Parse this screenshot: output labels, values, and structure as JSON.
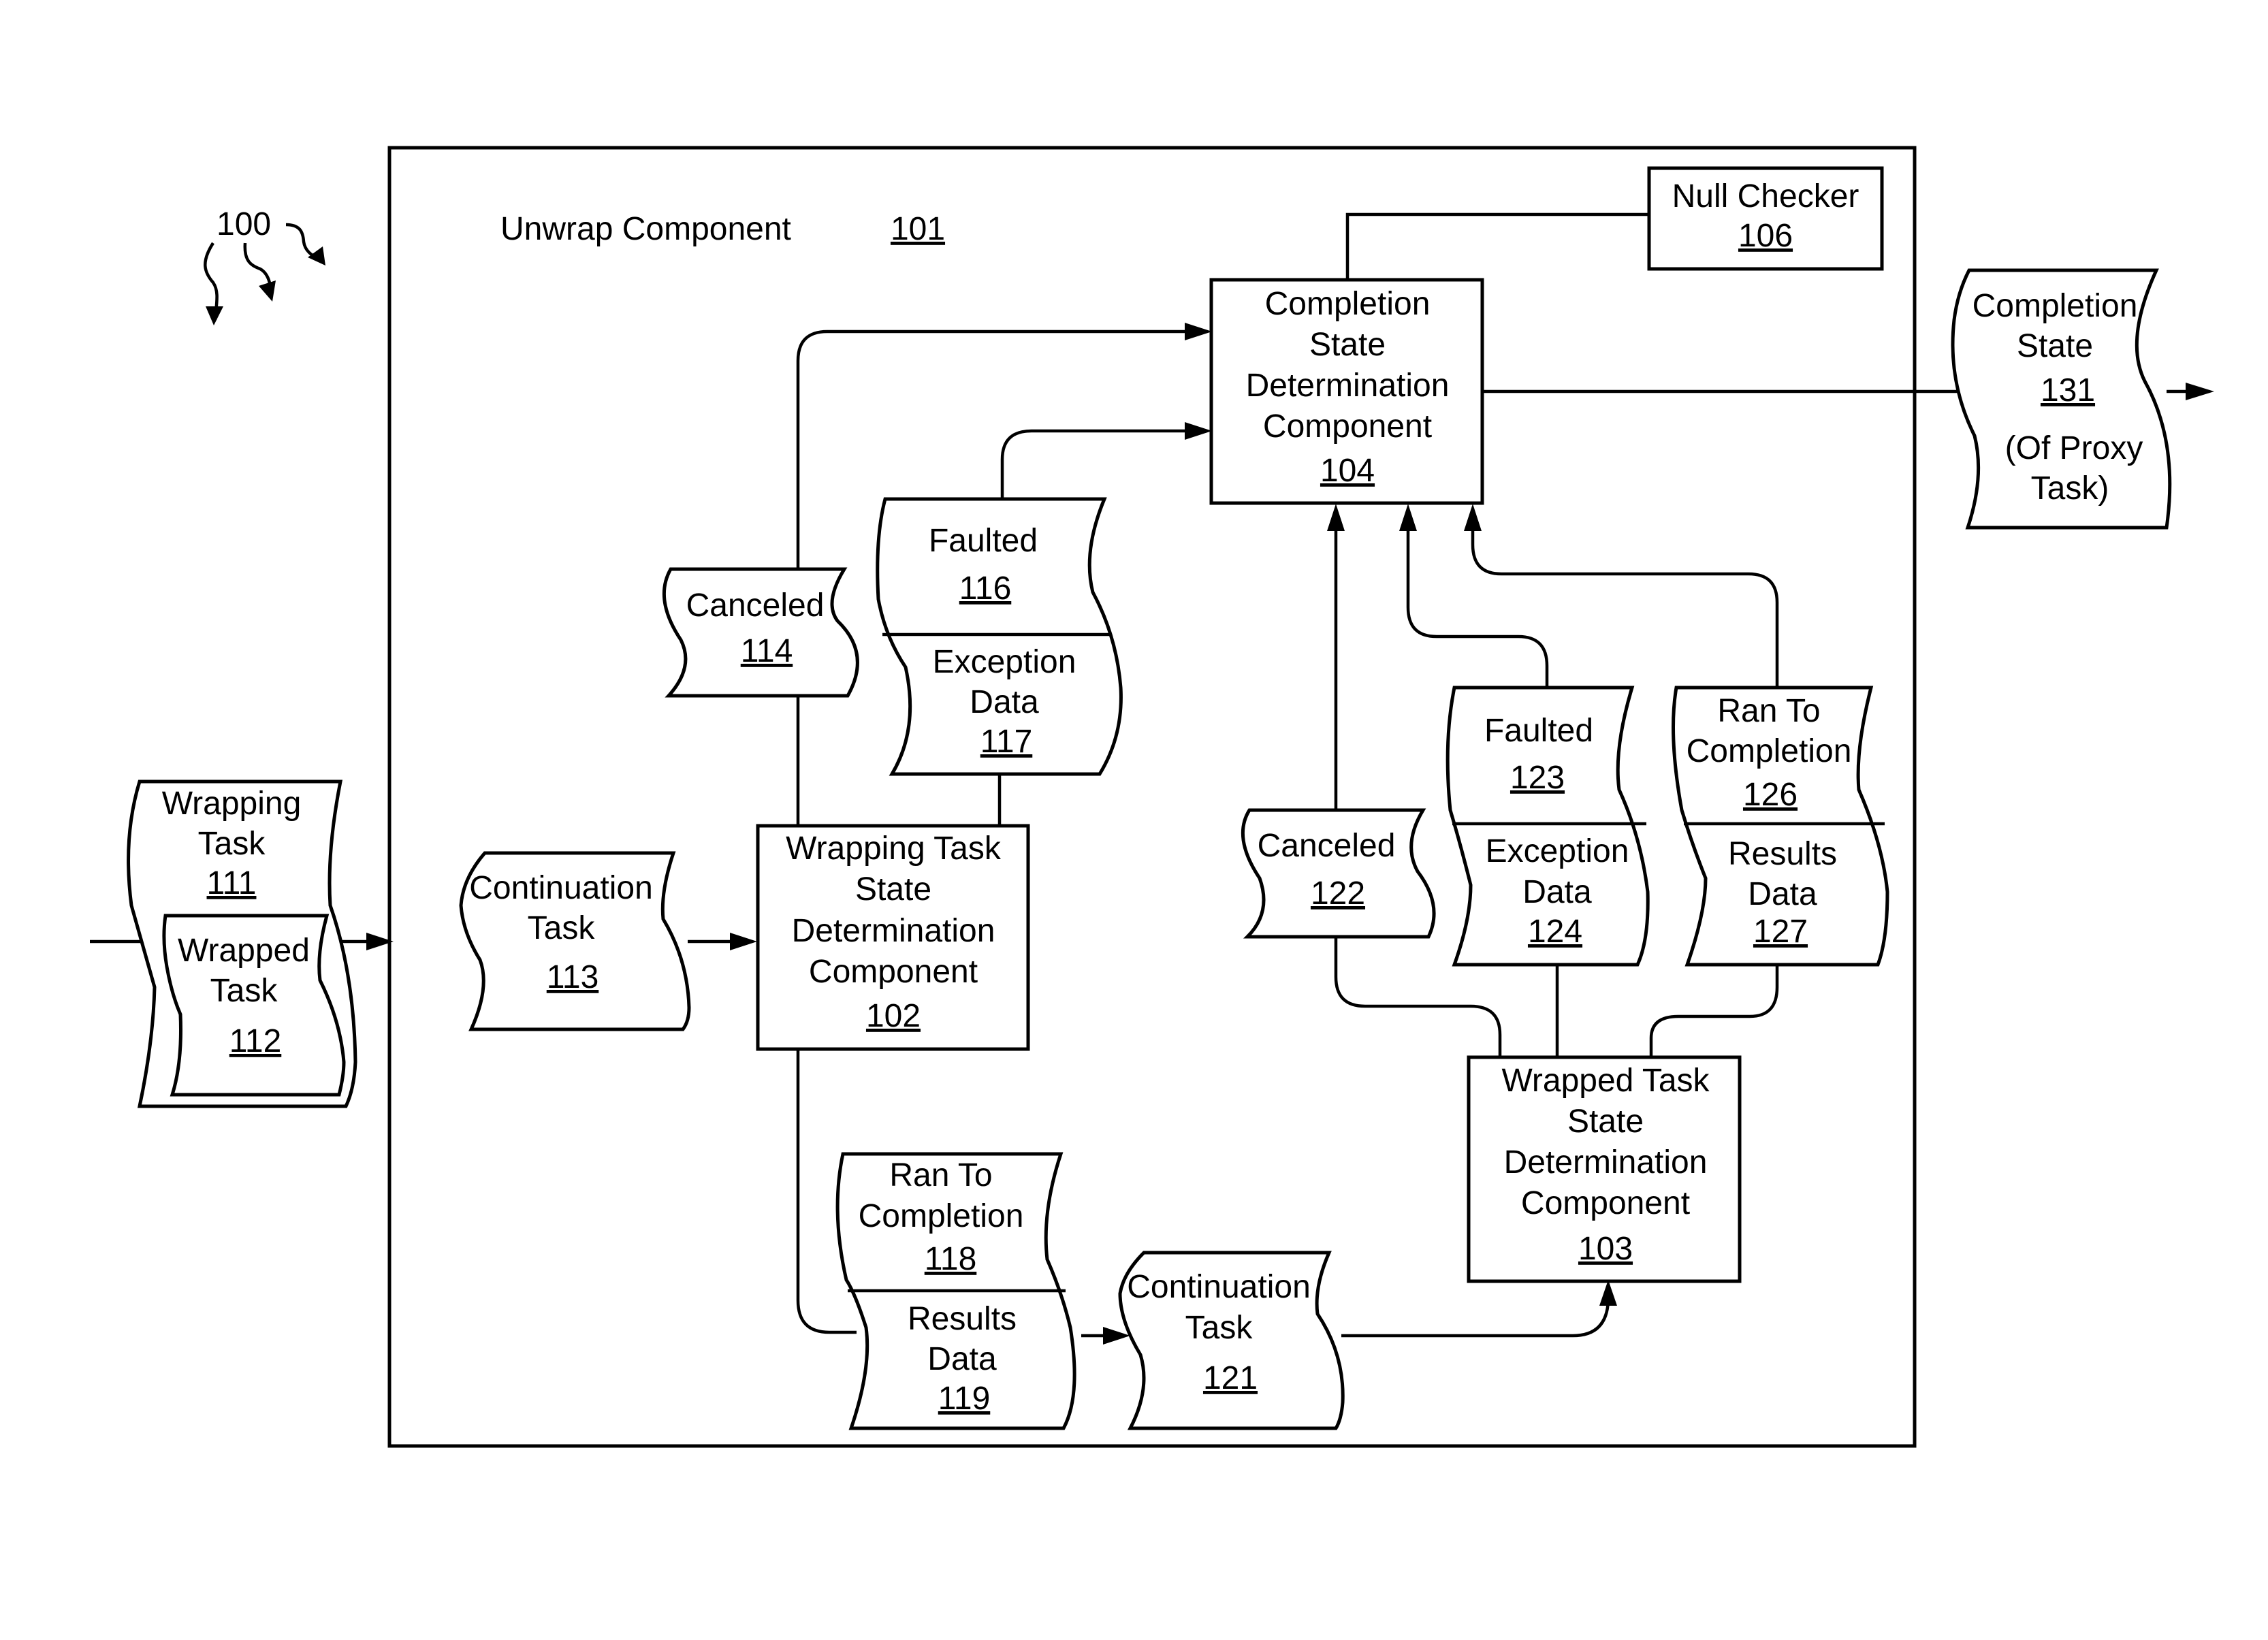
{
  "figure": {
    "figure_ref": "100",
    "container": {
      "title": "Unwrap Component",
      "ref": "101"
    }
  },
  "components": {
    "wrapping_task_state": {
      "lines": [
        "Wrapping Task",
        "State",
        "Determination",
        "Component"
      ],
      "ref": "102"
    },
    "wrapped_task_state": {
      "lines": [
        "Wrapped Task",
        "State",
        "Determination",
        "Component"
      ],
      "ref": "103"
    },
    "completion_state_det": {
      "lines": [
        "Completion",
        "State",
        "Determination",
        "Component"
      ],
      "ref": "104"
    },
    "null_checker": {
      "lines": [
        "Null Checker"
      ],
      "ref": "106"
    }
  },
  "data_items": {
    "wrapping_task": {
      "lines": [
        "Wrapping",
        "Task"
      ],
      "ref": "111"
    },
    "wrapped_task": {
      "lines": [
        "Wrapped",
        "Task"
      ],
      "ref": "112"
    },
    "continuation_task_113": {
      "lines": [
        "Continuation",
        "Task"
      ],
      "ref": "113"
    },
    "canceled_114": {
      "lines": [
        "Canceled"
      ],
      "ref": "114"
    },
    "faulted_116": {
      "lines": [
        "Faulted"
      ],
      "ref": "116"
    },
    "exception_data_117": {
      "lines": [
        "Exception",
        "Data"
      ],
      "ref": "117"
    },
    "ran_to_completion_118": {
      "lines": [
        "Ran To",
        "Completion"
      ],
      "ref": "118"
    },
    "results_data_119": {
      "lines": [
        "Results",
        "Data"
      ],
      "ref": "119"
    },
    "continuation_task_121": {
      "lines": [
        "Continuation",
        "Task"
      ],
      "ref": "121"
    },
    "canceled_122": {
      "lines": [
        "Canceled"
      ],
      "ref": "122"
    },
    "faulted_123": {
      "lines": [
        "Faulted"
      ],
      "ref": "123"
    },
    "exception_data_124": {
      "lines": [
        "Exception",
        "Data"
      ],
      "ref": "124"
    },
    "ran_to_completion_126": {
      "lines": [
        "Ran To",
        "Completion"
      ],
      "ref": "126"
    },
    "results_data_127": {
      "lines": [
        "Results",
        "Data"
      ],
      "ref": "127"
    },
    "completion_state_131": {
      "lines": [
        "Completion",
        "State"
      ],
      "ref": "131",
      "note_lines": [
        "(Of Proxy",
        "Task)"
      ]
    }
  }
}
